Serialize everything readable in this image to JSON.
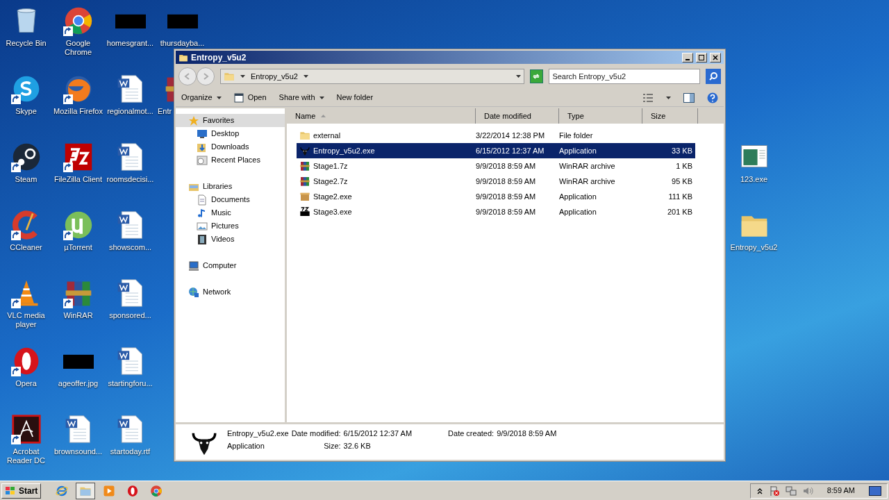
{
  "desktop": {
    "columns": [
      [
        {
          "label": "Recycle Bin",
          "kind": "recycle",
          "shortcut": false
        },
        {
          "label": "Skype",
          "kind": "skype",
          "shortcut": true
        },
        {
          "label": "Steam",
          "kind": "steam",
          "shortcut": true
        },
        {
          "label": "CCleaner",
          "kind": "ccleaner",
          "shortcut": true
        },
        {
          "label": "VLC media player",
          "kind": "vlc",
          "shortcut": true
        },
        {
          "label": "Opera",
          "kind": "opera",
          "shortcut": true
        },
        {
          "label": "Acrobat Reader DC",
          "kind": "acrobat",
          "shortcut": true
        }
      ],
      [
        {
          "label": "Google Chrome",
          "kind": "chrome",
          "shortcut": true
        },
        {
          "label": "Mozilla Firefox",
          "kind": "firefox",
          "shortcut": true
        },
        {
          "label": "FileZilla Client",
          "kind": "filezilla",
          "shortcut": true
        },
        {
          "label": "µTorrent",
          "kind": "utorrent",
          "shortcut": true
        },
        {
          "label": "WinRAR",
          "kind": "winrar",
          "shortcut": true
        },
        {
          "label": "ageoffer.jpg",
          "kind": "blank",
          "shortcut": false
        },
        {
          "label": "brownsound...",
          "kind": "word",
          "shortcut": false
        }
      ],
      [
        {
          "label": "homesgrant...",
          "kind": "blank",
          "shortcut": false
        },
        {
          "label": "regionalmot...",
          "kind": "word",
          "shortcut": false
        },
        {
          "label": "roomsdecisi...",
          "kind": "word",
          "shortcut": false
        },
        {
          "label": "showscom...",
          "kind": "word",
          "shortcut": false
        },
        {
          "label": "sponsored...",
          "kind": "word",
          "shortcut": false
        },
        {
          "label": "startingforu...",
          "kind": "word",
          "shortcut": false
        },
        {
          "label": "startoday.rtf",
          "kind": "word",
          "shortcut": false
        }
      ],
      [
        {
          "label": "thursdayba...",
          "kind": "blank",
          "shortcut": false
        },
        {
          "label": "Entr",
          "kind": "winrar",
          "shortcut": false
        }
      ]
    ],
    "right_icons": [
      {
        "label": "123.exe",
        "kind": "app",
        "shortcut": false
      },
      {
        "label": "Entropy_v5u2",
        "kind": "folder",
        "shortcut": false
      }
    ]
  },
  "window": {
    "title": "Entropy_v5u2",
    "address": {
      "path": "Entropy_v5u2"
    },
    "search": {
      "placeholder": "Search Entropy_v5u2"
    },
    "toolbar": [
      {
        "label": "Organize",
        "dropdown": true,
        "kind": "menu"
      },
      {
        "label": "Open",
        "dropdown": false,
        "kind": "open"
      },
      {
        "label": "Share with",
        "dropdown": true,
        "kind": "menu"
      },
      {
        "label": "New folder",
        "dropdown": false,
        "kind": "menu"
      }
    ],
    "navigation": [
      {
        "label": "Favorites",
        "kind": "star",
        "selected": true,
        "children": [
          {
            "label": "Desktop",
            "kind": "desktop",
            "selected": false
          },
          {
            "label": "Downloads",
            "kind": "downloads",
            "selected": false
          },
          {
            "label": "Recent Places",
            "kind": "recent",
            "selected": false
          }
        ]
      },
      {
        "label": "Libraries",
        "kind": "libraries",
        "selected": false,
        "children": [
          {
            "label": "Documents",
            "kind": "documents",
            "selected": false
          },
          {
            "label": "Music",
            "kind": "music",
            "selected": false
          },
          {
            "label": "Pictures",
            "kind": "pictures",
            "selected": false
          },
          {
            "label": "Videos",
            "kind": "videos",
            "selected": false
          }
        ]
      },
      {
        "label": "Computer",
        "kind": "computer",
        "selected": false
      },
      {
        "label": "Network",
        "kind": "network",
        "selected": false
      }
    ],
    "columns": [
      {
        "label": "Name",
        "sorted": true
      },
      {
        "label": "Date modified",
        "sorted": false
      },
      {
        "label": "Type",
        "sorted": false
      },
      {
        "label": "Size",
        "sorted": false
      }
    ],
    "files": [
      {
        "name": "external",
        "kind": "folder",
        "date": "3/22/2014 12:38 PM",
        "type": "File folder",
        "selected": false
      },
      {
        "name": "Entropy_v5u2.exe",
        "kind": "entropy",
        "date": "6/15/2012 12:37 AM",
        "type": "Application",
        "size": "33 KB",
        "selected": true
      },
      {
        "name": "Stage1.7z",
        "kind": "winrar",
        "date": "9/9/2018 8:59 AM",
        "type": "WinRAR archive",
        "size": "1 KB",
        "selected": false
      },
      {
        "name": "Stage2.7z",
        "kind": "winrar",
        "date": "9/9/2018 8:59 AM",
        "type": "WinRAR archive",
        "size": "95 KB",
        "selected": false
      },
      {
        "name": "Stage2.exe",
        "kind": "box",
        "date": "9/9/2018 8:59 AM",
        "type": "Application",
        "size": "111 KB",
        "selected": false
      },
      {
        "name": "Stage3.exe",
        "kind": "sfx",
        "date": "9/9/2018 8:59 AM",
        "type": "Application",
        "size": "201 KB",
        "selected": false
      }
    ],
    "details": {
      "name": "Entropy_v5u2.exe",
      "type": "Application",
      "fields": [
        {
          "label": "Date modified:",
          "value": "6/15/2012 12:37 AM"
        },
        {
          "label": "Size:",
          "value": "32.6 KB"
        },
        {
          "label": "Date created:",
          "value": "9/9/2018 8:59 AM"
        }
      ]
    }
  },
  "taskbar": {
    "start": "Start",
    "apps": [
      {
        "kind": "ie",
        "active": false
      },
      {
        "kind": "explorer",
        "active": true
      },
      {
        "kind": "media",
        "active": false
      },
      {
        "kind": "opera",
        "active": false
      },
      {
        "kind": "chrome",
        "active": false
      }
    ],
    "clock": "8:59 AM"
  }
}
